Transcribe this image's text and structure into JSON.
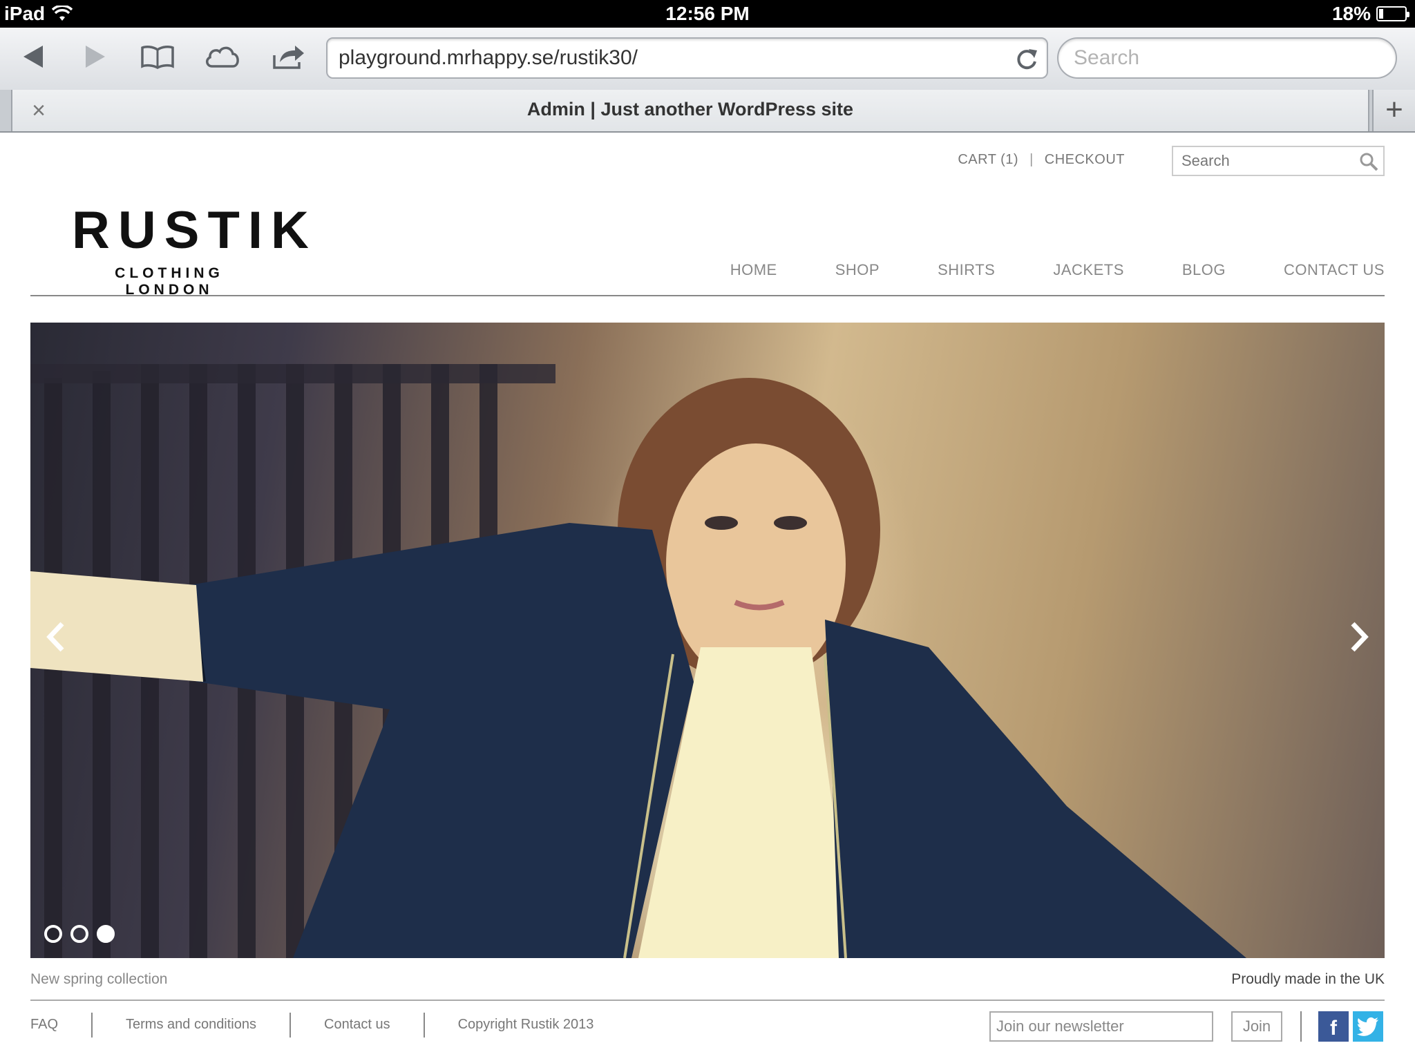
{
  "status_bar": {
    "device": "iPad",
    "time": "12:56 PM",
    "battery": "18%",
    "battery_level": 0.18
  },
  "browser": {
    "url": "playground.mrhappy.se/rustik30/",
    "search_placeholder": "Search",
    "tab_title": "Admin | Just another WordPress site",
    "tab_close": "×",
    "new_tab": "+",
    "icons": [
      "back-icon",
      "forward-icon",
      "bookmarks-icon",
      "icloud-icon",
      "share-icon",
      "reload-icon"
    ]
  },
  "site": {
    "utility": {
      "cart": "CART (1)",
      "separator": "|",
      "checkout": "CHECKOUT"
    },
    "search_placeholder": "Search",
    "logo": {
      "name": "RUSTIK",
      "tagline": "CLOTHING LONDON"
    },
    "nav": [
      "HOME",
      "SHOP",
      "SHIRTS",
      "JACKETS",
      "BLOG",
      "CONTACT US"
    ],
    "slider": {
      "slides": 3,
      "active": 3
    },
    "caption_left": "New spring collection",
    "caption_right": "Proudly made in the UK",
    "footer_links": [
      "FAQ",
      "Terms and conditions",
      "Contact us",
      "Copyright Rustik 2013"
    ],
    "newsletter_placeholder": "Join our newsletter",
    "join_label": "Join",
    "facebook": "f",
    "colors": {
      "facebook": "#3b5998",
      "twitter": "#33b2e6"
    }
  }
}
